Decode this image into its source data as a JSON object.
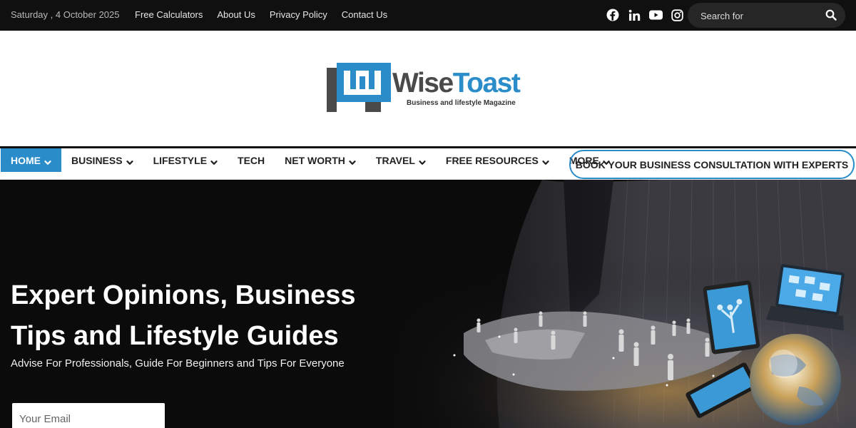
{
  "topbar": {
    "date": "Saturday , 4 October 2025",
    "links": [
      "Free Calculators",
      "About Us",
      "Privacy Policy",
      "Contact Us"
    ],
    "social_icons": [
      "facebook-icon",
      "linkedin-icon",
      "youtube-icon",
      "instagram-icon"
    ],
    "search_placeholder": "Search for"
  },
  "logo": {
    "name_part1": "Wise",
    "name_part2": "Toast",
    "tagline": "Business and lifestyle Magazine"
  },
  "nav": {
    "items": [
      {
        "label": "HOME",
        "dropdown": true,
        "active": true
      },
      {
        "label": "BUSINESS",
        "dropdown": true
      },
      {
        "label": "LIFESTYLE",
        "dropdown": true
      },
      {
        "label": "TECH",
        "dropdown": false
      },
      {
        "label": "NET WORTH",
        "dropdown": true
      },
      {
        "label": "TRAVEL",
        "dropdown": true
      },
      {
        "label": "FREE RESOURCES",
        "dropdown": true
      },
      {
        "label": "MORE",
        "dropdown": true
      }
    ],
    "cta": "BOOK YOUR BUSINESS CONSULTATION WITH EXPERTS"
  },
  "hero": {
    "headline_line1": "Expert Opinions, Business",
    "headline_line2": "Tips and Lifestyle Guides",
    "subheadline": "Advise For Professionals, Guide For Beginners and Tips For Everyone",
    "email_placeholder": "Your Email"
  },
  "colors": {
    "accent": "#2a8cc9",
    "topbar_bg": "#101010",
    "hero_bg": "#0b0b0b"
  }
}
